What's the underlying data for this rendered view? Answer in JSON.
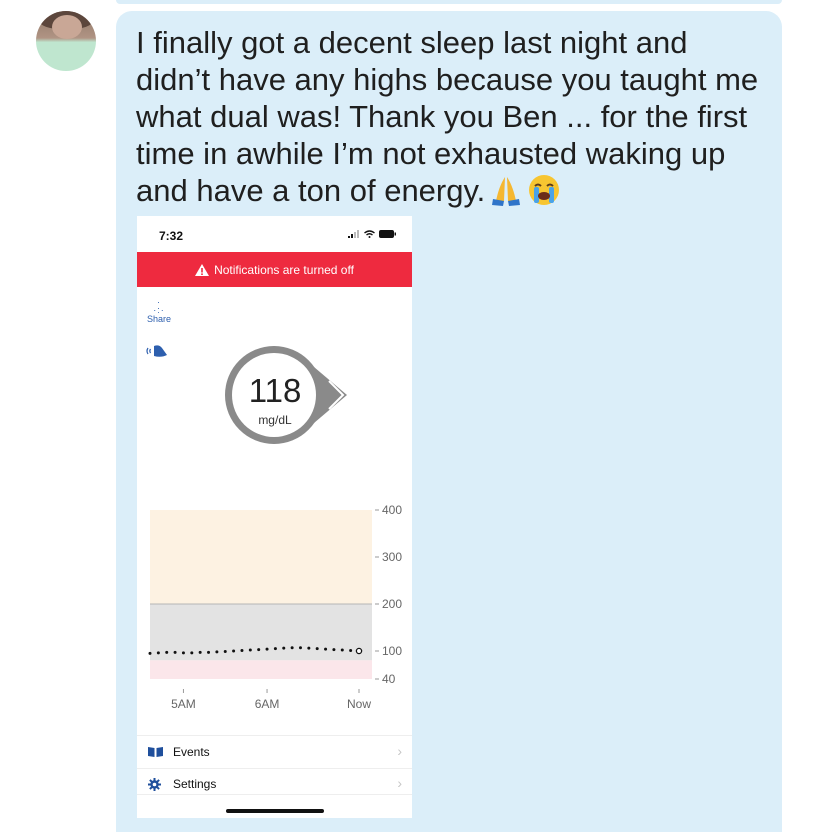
{
  "message": {
    "text": "I finally got a decent sleep last night and didn’t have any highs because you taught me what dual was! Thank you Ben ... for the first time in awhile I’m not exhausted waking up and have a ton of energy.",
    "emojis": [
      "folded-hands-emoji",
      "loudly-crying-face-emoji"
    ]
  },
  "screenshot": {
    "status_time": "7:32",
    "banner_text": "Notifications are turned off",
    "share_label": "Share",
    "glucose_value": "118",
    "glucose_unit": "mg/dL",
    "trend": "steady-arrow",
    "colors": {
      "banner": "#ee2a3f",
      "high_zone": "#fdf2e2",
      "target_zone": "#e3e3e3",
      "low_zone": "#fbe6ea",
      "gauge_ring": "#8a8a8a",
      "link_blue": "#2d5fae"
    },
    "menu": [
      {
        "label": "Events",
        "icon": "book-icon"
      },
      {
        "label": "Settings",
        "icon": "gear-icon"
      }
    ]
  },
  "chart_data": {
    "type": "line",
    "x_ticks": [
      "5AM",
      "6AM",
      "Now"
    ],
    "y_ticks": [
      "400",
      "300",
      "200",
      "100",
      "40"
    ],
    "ylim": [
      40,
      400
    ],
    "target_range": [
      80,
      200
    ],
    "series": [
      {
        "points": [
          [
            0,
            95
          ],
          [
            3,
            96
          ],
          [
            6,
            97
          ],
          [
            9,
            97
          ],
          [
            12,
            96
          ],
          [
            15,
            96
          ],
          [
            18,
            97
          ],
          [
            21,
            97
          ],
          [
            24,
            98
          ],
          [
            27,
            99
          ],
          [
            30,
            100
          ],
          [
            33,
            101
          ],
          [
            36,
            102
          ],
          [
            39,
            103
          ],
          [
            42,
            104
          ],
          [
            45,
            105
          ],
          [
            48,
            106
          ],
          [
            51,
            107
          ],
          [
            54,
            107
          ],
          [
            57,
            106
          ],
          [
            60,
            105
          ],
          [
            63,
            104
          ],
          [
            66,
            103
          ],
          [
            69,
            102
          ],
          [
            72,
            101
          ],
          [
            75,
            100
          ]
        ]
      }
    ],
    "x_range": [
      0,
      75
    ],
    "x_tick_positions": [
      12,
      42,
      75
    ]
  }
}
